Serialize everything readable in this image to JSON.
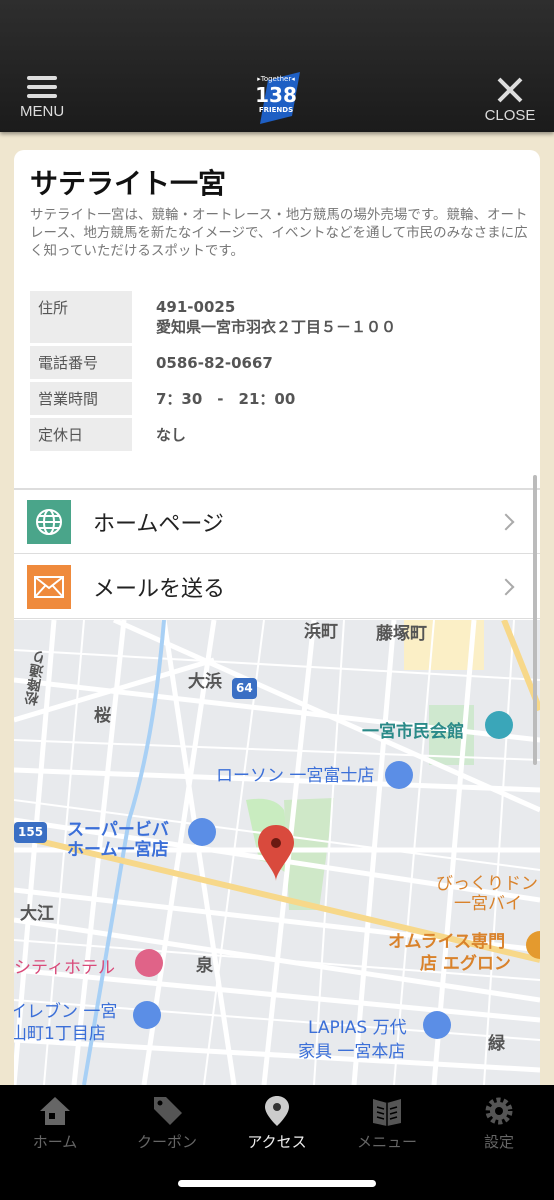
{
  "header": {
    "menu_label": "MENU",
    "close_label": "CLOSE",
    "logo_text": "Together 138 FRIENDS"
  },
  "spot": {
    "title": "サテライト一宮",
    "description": "サテライト一宮は、競輪・オートレース・地方競馬の場外売場です。競輪、オートレース、地方競馬を新たなイメージで、イベントなどを通して市民のみなさまに広く知っていただけるスポットです。",
    "info": [
      {
        "label": "住所",
        "value": "491-0025",
        "value2": "愛知県一宮市羽衣２丁目５－１００"
      },
      {
        "label": "電話番号",
        "value": "0586-82-0667"
      },
      {
        "label": "営業時間",
        "value": "7：30　-　21：00"
      },
      {
        "label": "定休日",
        "value": "なし"
      }
    ]
  },
  "links": [
    {
      "label": "ホームページ",
      "icon": "globe-icon",
      "color": "#4aa58a"
    },
    {
      "label": "メールを送る",
      "icon": "mail-icon",
      "color": "#ef8a3c"
    }
  ],
  "map": {
    "labels": [
      "浜町",
      "藤塚町",
      "大浜",
      "64",
      "松降通り",
      "桜",
      "一宮市民会館",
      "ローソン 一宮富士店",
      "155",
      "スーパービバ",
      "ホーム一宮店",
      "びっくりドン",
      "一宮バイ",
      "大江",
      "オムライス専門",
      "店 エグロン",
      "シティホテル",
      "泉",
      "イレブン 一宮",
      "山町1丁目店",
      "LAPIAS 万代",
      "家具 一宮本店",
      "緑"
    ]
  },
  "tabs": [
    {
      "label": "ホーム",
      "icon": "home-icon"
    },
    {
      "label": "クーポン",
      "icon": "tag-icon"
    },
    {
      "label": "アクセス",
      "icon": "map-pin-icon",
      "active": true
    },
    {
      "label": "メニュー",
      "icon": "book-icon"
    },
    {
      "label": "設定",
      "icon": "gear-icon"
    }
  ]
}
